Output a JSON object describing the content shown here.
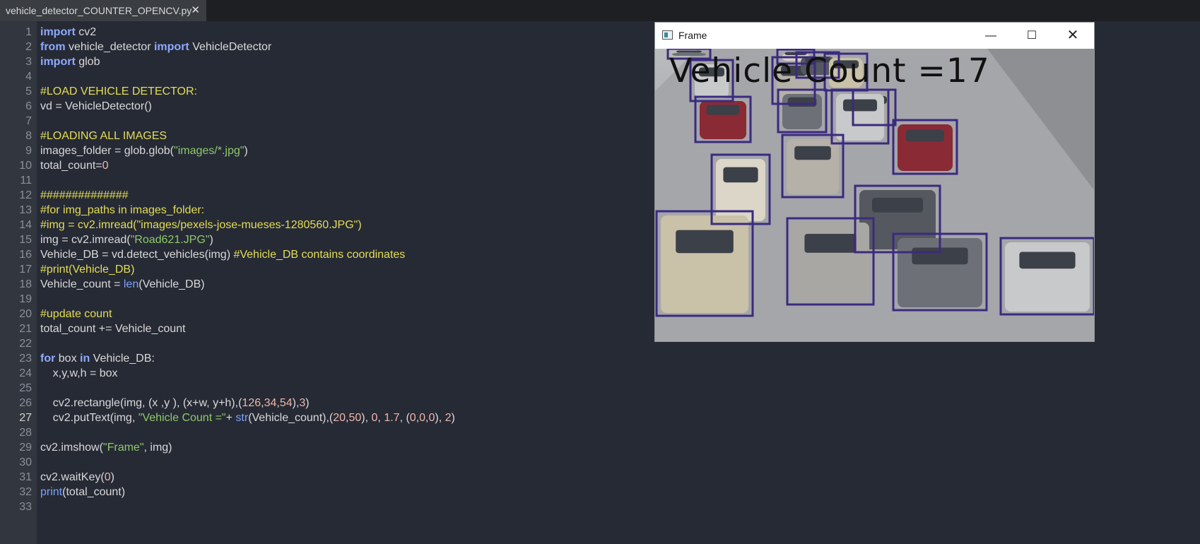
{
  "tab": {
    "filename": "vehicle_detector_COUNTER_OPENCV.py",
    "close_glyph": "✕"
  },
  "code_lines": [
    [
      {
        "t": "kw",
        "v": "import"
      },
      {
        "t": "op",
        "v": " cv2"
      }
    ],
    [
      {
        "t": "kw",
        "v": "from"
      },
      {
        "t": "op",
        "v": " vehicle_detector "
      },
      {
        "t": "kw",
        "v": "import"
      },
      {
        "t": "op",
        "v": " VehicleDetector"
      }
    ],
    [
      {
        "t": "kw",
        "v": "import"
      },
      {
        "t": "op",
        "v": " glob"
      }
    ],
    [],
    [
      {
        "t": "cm",
        "v": "#LOAD VEHICLE DETECTOR:"
      }
    ],
    [
      {
        "t": "op",
        "v": "vd = VehicleDetector()"
      }
    ],
    [],
    [
      {
        "t": "cm",
        "v": "#LOADING ALL IMAGES"
      }
    ],
    [
      {
        "t": "op",
        "v": "images_folder = glob.glob("
      },
      {
        "t": "st",
        "v": "\"images/*.jpg\""
      },
      {
        "t": "op",
        "v": ")"
      }
    ],
    [
      {
        "t": "op",
        "v": "total_count="
      },
      {
        "t": "nu",
        "v": "0"
      }
    ],
    [],
    [
      {
        "t": "cm",
        "v": "##############"
      }
    ],
    [
      {
        "t": "cm",
        "v": "#for img_paths in images_folder:"
      }
    ],
    [
      {
        "t": "cm",
        "v": "#img = cv2.imread(\"images/pexels-jose-mueses-1280560.JPG\")"
      }
    ],
    [
      {
        "t": "op",
        "v": "img = cv2.imread("
      },
      {
        "t": "st",
        "v": "\"Road621.JPG\""
      },
      {
        "t": "op",
        "v": ")"
      }
    ],
    [
      {
        "t": "op",
        "v": "Vehicle_DB = vd.detect_vehicles(img) "
      },
      {
        "t": "cm",
        "v": "#Vehicle_DB contains coordinates"
      }
    ],
    [
      {
        "t": "cm",
        "v": "#print(Vehicle_DB)"
      }
    ],
    [
      {
        "t": "op",
        "v": "Vehicle_count = "
      },
      {
        "t": "fn",
        "v": "len"
      },
      {
        "t": "op",
        "v": "(Vehicle_DB)"
      }
    ],
    [],
    [
      {
        "t": "cm",
        "v": "#update count"
      }
    ],
    [
      {
        "t": "op",
        "v": "total_count += Vehicle_count"
      }
    ],
    [],
    [
      {
        "t": "kw",
        "v": "for"
      },
      {
        "t": "op",
        "v": " box "
      },
      {
        "t": "kw",
        "v": "in"
      },
      {
        "t": "op",
        "v": " Vehicle_DB:"
      }
    ],
    [
      {
        "t": "op",
        "v": "    x,y,w,h = box"
      }
    ],
    [],
    [
      {
        "t": "op",
        "v": "    cv2.rectangle(img, (x ,y ), (x+w, y+h),("
      },
      {
        "t": "nu",
        "v": "126"
      },
      {
        "t": "op",
        "v": ","
      },
      {
        "t": "nu",
        "v": "34"
      },
      {
        "t": "op",
        "v": ","
      },
      {
        "t": "nu",
        "v": "54"
      },
      {
        "t": "op",
        "v": "),"
      },
      {
        "t": "nu",
        "v": "3"
      },
      {
        "t": "op",
        "v": ")"
      }
    ],
    [
      {
        "t": "op",
        "v": "    cv2.putText(img, "
      },
      {
        "t": "st",
        "v": "\"Vehicle Count =\""
      },
      {
        "t": "op",
        "v": "+ "
      },
      {
        "t": "fn",
        "v": "str"
      },
      {
        "t": "op",
        "v": "(Vehicle_count),("
      },
      {
        "t": "nu",
        "v": "20"
      },
      {
        "t": "op",
        "v": ","
      },
      {
        "t": "nu",
        "v": "50"
      },
      {
        "t": "op",
        "v": "), "
      },
      {
        "t": "nu",
        "v": "0"
      },
      {
        "t": "op",
        "v": ", "
      },
      {
        "t": "nu",
        "v": "1.7"
      },
      {
        "t": "op",
        "v": ", ("
      },
      {
        "t": "nu",
        "v": "0"
      },
      {
        "t": "op",
        "v": ","
      },
      {
        "t": "nu",
        "v": "0"
      },
      {
        "t": "op",
        "v": ","
      },
      {
        "t": "nu",
        "v": "0"
      },
      {
        "t": "op",
        "v": "), "
      },
      {
        "t": "nu",
        "v": "2"
      },
      {
        "t": "op",
        "v": ")"
      }
    ],
    [],
    [
      {
        "t": "op",
        "v": "cv2.imshow("
      },
      {
        "t": "st",
        "v": "\"Frame\""
      },
      {
        "t": "op",
        "v": ", img)"
      }
    ],
    [],
    [
      {
        "t": "op",
        "v": "cv2.waitKey("
      },
      {
        "t": "nu",
        "v": "0"
      },
      {
        "t": "op",
        "v": ")"
      }
    ],
    [
      {
        "t": "fn",
        "v": "print"
      },
      {
        "t": "op",
        "v": "(total_count)"
      }
    ],
    []
  ],
  "active_line": 27,
  "frame_window": {
    "title": "Frame",
    "minimize_glyph": "—",
    "maximize_glyph": "☐",
    "close_glyph": "✕",
    "overlay_text": "Vehicle Count =17",
    "box_color": "#3b2a7e",
    "image_description_icon": "road-traffic-image"
  },
  "colors": {
    "background": "#262a35",
    "gutter": "#32363f",
    "keyword": "#8fa9ff",
    "comment": "#e4dd55",
    "string": "#8ec96a",
    "number": "#f0b6a8"
  }
}
